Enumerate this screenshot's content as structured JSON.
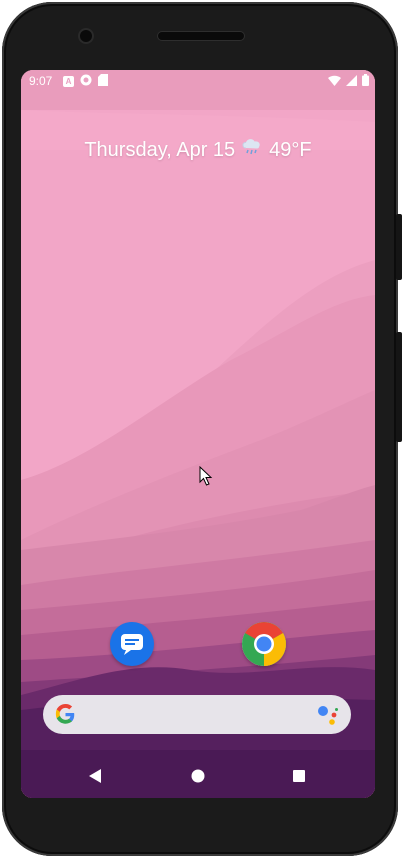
{
  "status_bar": {
    "time": "9:07",
    "notification_icons": [
      "autofill-icon",
      "assistant-icon",
      "sd-card-icon"
    ],
    "system_icons": [
      "wifi-icon",
      "signal-icon",
      "battery-icon"
    ]
  },
  "date_widget": {
    "date": "Thursday, Apr 15",
    "weather_icon": "rain-cloud-icon",
    "temperature": "49°F"
  },
  "dock": {
    "apps": [
      {
        "name": "Messages",
        "icon": "messages-icon",
        "color": "#1a73e8"
      },
      {
        "name": "Chrome",
        "icon": "chrome-icon",
        "color": "#4285f4"
      }
    ]
  },
  "search_bar": {
    "left_icon": "google-g-icon",
    "right_icon": "google-assistant-icon"
  },
  "nav_bar": {
    "buttons": [
      "back-button",
      "home-button",
      "recents-button"
    ]
  },
  "colors": {
    "wallpaper_top": "#f2a6c7",
    "wallpaper_bottom": "#4e1856",
    "google_blue": "#4285f4",
    "google_red": "#ea4335",
    "google_yellow": "#fbbc05",
    "google_green": "#34a853"
  }
}
